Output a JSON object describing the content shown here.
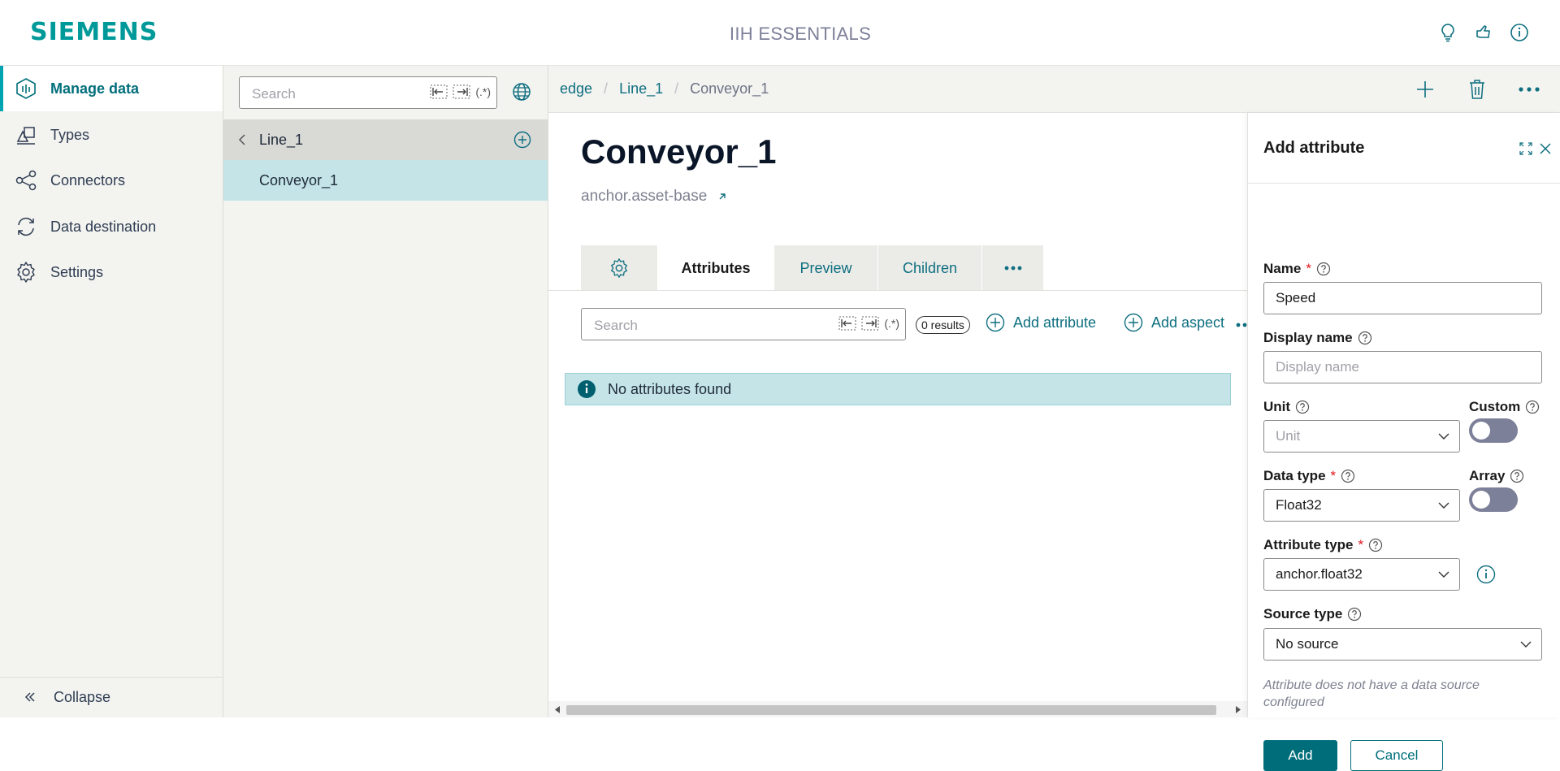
{
  "header": {
    "brand": "SIEMENS",
    "app_title": "IIH ESSENTIALS"
  },
  "nav": {
    "items": [
      {
        "label": "Manage data"
      },
      {
        "label": "Types"
      },
      {
        "label": "Connectors"
      },
      {
        "label": "Data destination"
      },
      {
        "label": "Settings"
      }
    ],
    "collapse_label": "Collapse"
  },
  "tree": {
    "search_placeholder": "Search",
    "regex_label": "(.*)",
    "parent_label": "Line_1",
    "child_label": "Conveyor_1"
  },
  "breadcrumb": [
    "edge",
    "Line_1",
    "Conveyor_1"
  ],
  "asset": {
    "title": "Conveyor_1",
    "type": "anchor.asset-base"
  },
  "tabs": [
    "Attributes",
    "Preview",
    "Children"
  ],
  "attributes": {
    "search_placeholder": "Search",
    "regex_label": "(.*)",
    "results": "0 results",
    "add_attribute": "Add attribute",
    "add_aspect": "Add aspect",
    "empty_message": "No attributes found"
  },
  "panel": {
    "title": "Add attribute",
    "name_label": "Name",
    "name_value": "Speed",
    "display_name_label": "Display name",
    "display_name_placeholder": "Display name",
    "unit_label": "Unit",
    "unit_placeholder": "Unit",
    "custom_label": "Custom",
    "custom_on": false,
    "data_type_label": "Data type",
    "data_type_value": "Float32",
    "array_label": "Array",
    "array_on": false,
    "attribute_type_label": "Attribute type",
    "attribute_type_value": "anchor.float32",
    "source_type_label": "Source type",
    "source_type_value": "No source",
    "hint": "Attribute does not have a data source configured",
    "required_marker": "*",
    "add_button": "Add",
    "cancel_button": "Cancel"
  },
  "colors": {
    "brand": "#009999",
    "accent": "#006e7a",
    "selected_row": "#c4e4e8"
  }
}
